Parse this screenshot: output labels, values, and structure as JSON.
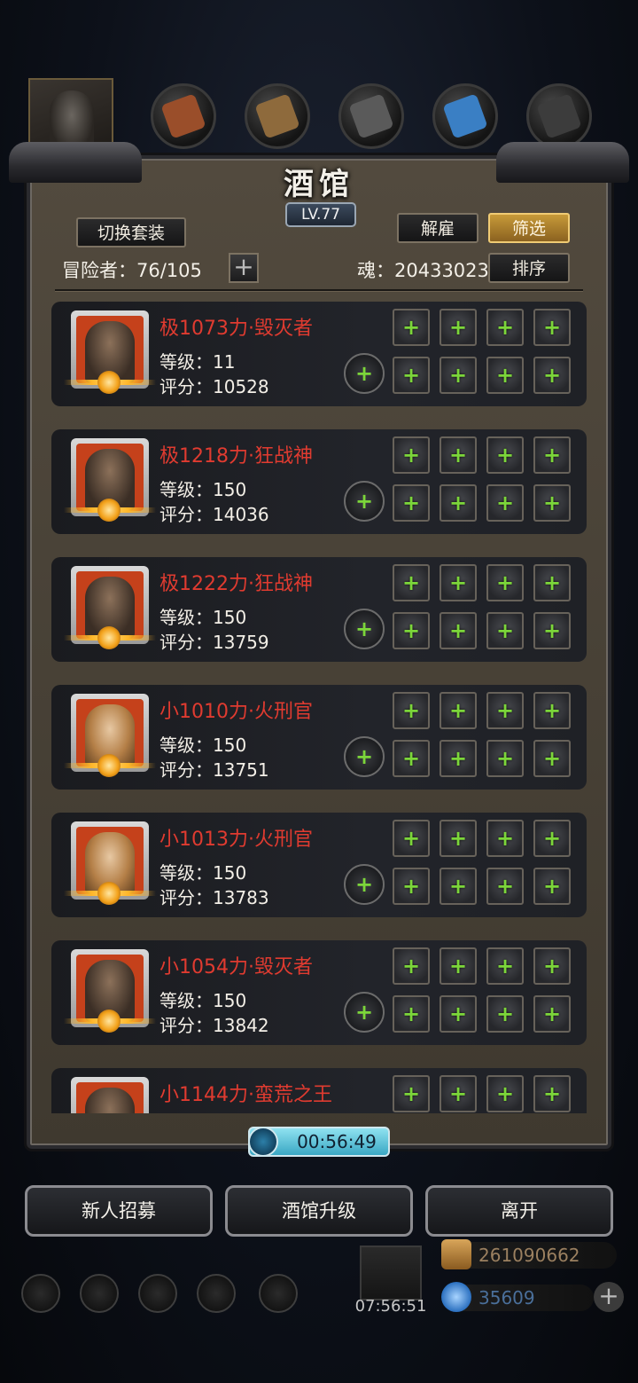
{
  "title": "酒馆",
  "level": "LV.77",
  "buttons": {
    "switch_outfit": "切换套装",
    "dismiss": "解雇",
    "filter": "筛选",
    "sort": "排序"
  },
  "adventurers_label": "冒险者：76/105",
  "soul_label": "魂：20433023",
  "heroes": [
    {
      "name": "极1073力·毁灭者",
      "level": "等级：11",
      "score": "评分：10528",
      "gender": "male"
    },
    {
      "name": "极1218力·狂战神",
      "level": "等级：150",
      "score": "评分：14036",
      "gender": "male"
    },
    {
      "name": "极1222力·狂战神",
      "level": "等级：150",
      "score": "评分：13759",
      "gender": "male"
    },
    {
      "name": "小1010力·火刑官",
      "level": "等级：150",
      "score": "评分：13751",
      "gender": "female"
    },
    {
      "name": "小1013力·火刑官",
      "level": "等级：150",
      "score": "评分：13783",
      "gender": "female"
    },
    {
      "name": "小1054力·毁灭者",
      "level": "等级：150",
      "score": "评分：13842",
      "gender": "male"
    },
    {
      "name": "小1144力·蛮荒之王",
      "level": "",
      "score": "",
      "gender": "male"
    }
  ],
  "timer": "00:56:49",
  "bottom_buttons": {
    "recruit": "新人招募",
    "upgrade": "酒馆升级",
    "leave": "离开"
  },
  "gift_timer": "07:56:51",
  "resources": {
    "gold": "261090662",
    "gems": "35609"
  },
  "colors": {
    "hero_name": "#e03b30",
    "slot_plus": "#7cd63a",
    "gold_button": "#c79a39"
  }
}
